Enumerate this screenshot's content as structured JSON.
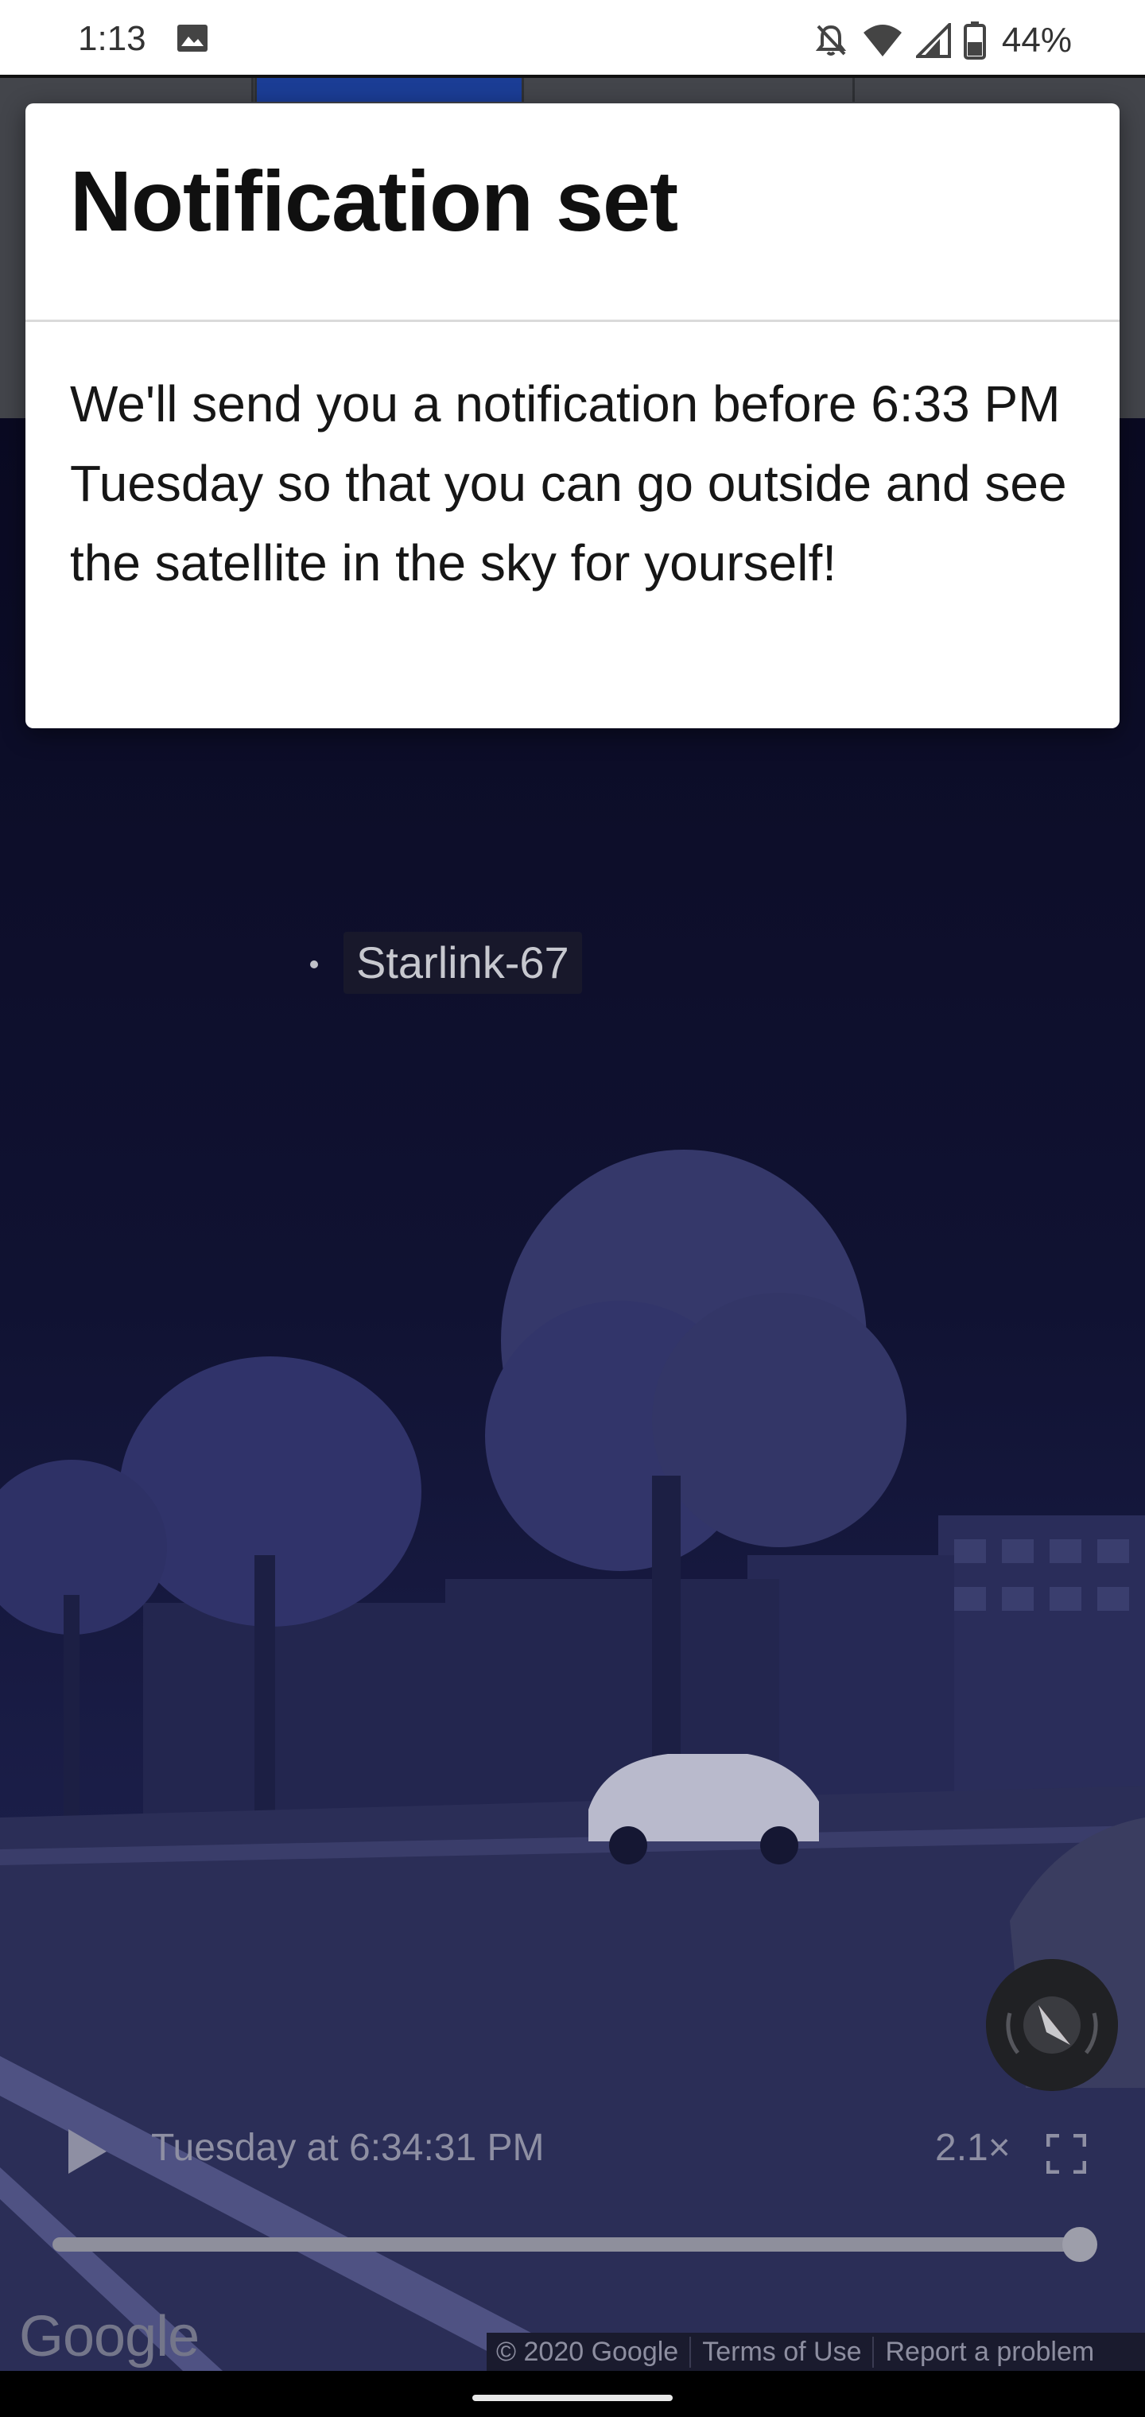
{
  "status_bar": {
    "time": "1:13",
    "battery_percent": "44%",
    "icons": [
      "gallery-icon",
      "notifications-off-icon",
      "wifi-icon",
      "signal-icon",
      "battery-icon"
    ]
  },
  "dialog": {
    "title": "Notification set",
    "body": "We'll send you a notification before 6:33 PM Tuesday so that you can go outside and see the satellite in the sky for yourself!"
  },
  "sky_view": {
    "satellite_label": "Starlink-67"
  },
  "playback": {
    "time": "Tuesday at 6:34:31 PM",
    "speed": "2.1×",
    "progress": 0.985
  },
  "map_footer": {
    "logo": "Google",
    "copyright": "© 2020 Google",
    "terms_link": "Terms of Use",
    "report_link": "Report a problem"
  },
  "colors": {
    "overlay_sky": "#0c0d24",
    "dialog_background": "#ffffff",
    "active_tab": "#1b3d95",
    "compass_needle": "#c0392b"
  }
}
